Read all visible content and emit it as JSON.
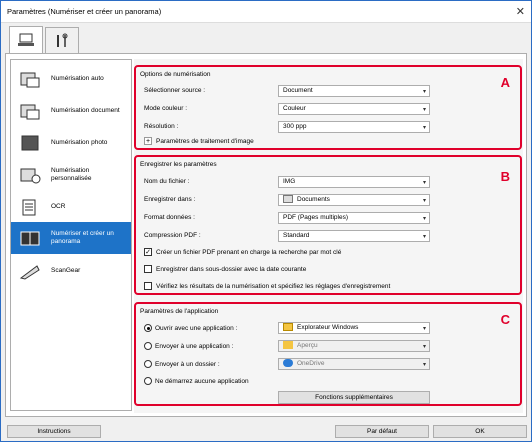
{
  "window": {
    "title": "Paramètres (Numériser et créer un panorama)",
    "close": "✕"
  },
  "tabs": [
    {
      "name": "scanner-tab"
    },
    {
      "name": "tools-tab"
    }
  ],
  "sidebar": {
    "items": [
      {
        "label": "Numérisation auto"
      },
      {
        "label": "Numérisation document"
      },
      {
        "label": "Numérisation photo"
      },
      {
        "label": "Numérisation personnalisée"
      },
      {
        "label": "OCR"
      },
      {
        "label": "Numériser et créer un panorama"
      },
      {
        "label": "ScanGear"
      }
    ]
  },
  "scan_options": {
    "title": "Options de numérisation",
    "letter": "A",
    "source_label": "Sélectionner source :",
    "source_value": "Document",
    "color_label": "Mode couleur :",
    "color_value": "Couleur",
    "resolution_label": "Résolution :",
    "resolution_value": "300 ppp",
    "image_processing": "Paramètres de traitement d'image"
  },
  "save_settings": {
    "title": "Enregistrer les paramètres",
    "letter": "B",
    "filename_label": "Nom du fichier :",
    "filename_value": "IMG",
    "savein_label": "Enregistrer dans :",
    "savein_value": "Documents",
    "format_label": "Format données :",
    "format_value": "PDF (Pages multiples)",
    "compression_label": "Compression PDF :",
    "compression_value": "Standard",
    "cb_searchable": "Créer un fichier PDF prenant en charge la recherche par mot clé",
    "cb_subfolder": "Enregistrer dans sous-dossier avec la date courante",
    "cb_verify": "Vérifiez les résultats de la numérisation et spécifiez les réglages d'enregistrement"
  },
  "app_settings": {
    "title": "Paramètres de l'application",
    "letter": "C",
    "r_open": "Ouvrir avec une application :",
    "r_open_value": "Explorateur Windows",
    "r_send_app": "Envoyer à une application :",
    "r_send_app_value": "Aperçu",
    "r_send_folder": "Envoyer à un dossier :",
    "r_send_folder_value": "OneDrive",
    "r_none": "Ne démarrez aucune application",
    "more": "Fonctions supplémentaires"
  },
  "footer": {
    "instructions": "Instructions",
    "default": "Par défaut",
    "ok": "OK"
  },
  "colors": {
    "accent": "#1e73c8",
    "highlight": "#e0002b"
  }
}
